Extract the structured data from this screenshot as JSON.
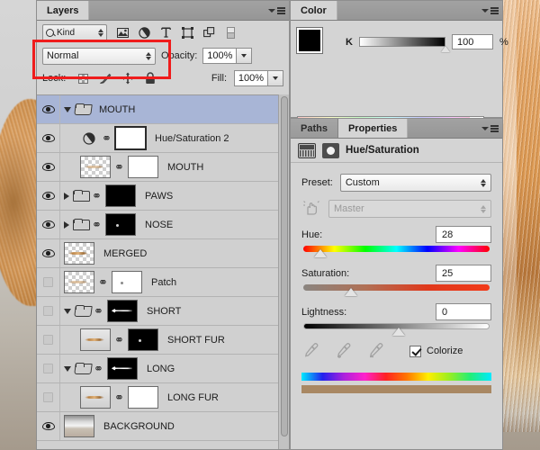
{
  "layers_panel": {
    "tab_label": "Layers",
    "panel_menu_icon": "panel-menu-icon",
    "filter": {
      "kind_label": "Kind",
      "search_icon": "magnifier-icon",
      "icons": [
        {
          "name": "filter-pixel-icon",
          "glyph": "☐"
        },
        {
          "name": "filter-adjustment-icon",
          "glyph": "◑"
        },
        {
          "name": "filter-type-icon",
          "glyph": "T"
        },
        {
          "name": "filter-shape-icon",
          "glyph": "⬚"
        },
        {
          "name": "filter-smart-object-icon",
          "glyph": "⧉"
        },
        {
          "name": "filter-toggle-icon",
          "glyph": "▤"
        }
      ]
    },
    "blend": {
      "mode": "Normal",
      "opacity_label": "Opacity:",
      "opacity_value": "100%"
    },
    "lock": {
      "label": "Lock:",
      "icons": [
        {
          "name": "lock-transparency-icon"
        },
        {
          "name": "lock-image-icon"
        },
        {
          "name": "lock-position-icon"
        },
        {
          "name": "lock-all-icon"
        }
      ],
      "fill_label": "Fill:",
      "fill_value": "100%"
    },
    "layers": [
      {
        "name": "MOUTH",
        "visible": true,
        "selected": true,
        "type": "group",
        "indent": 0,
        "expanded": true,
        "thumb": "none",
        "mask": "none",
        "linked": false
      },
      {
        "name": "Hue/Saturation 2",
        "visible": true,
        "selected": false,
        "type": "adjustment",
        "indent": 1,
        "expanded": null,
        "thumb": "adjustment",
        "mask": "white-framed",
        "linked": true
      },
      {
        "name": "MOUTH",
        "visible": true,
        "selected": false,
        "type": "pixel",
        "indent": 1,
        "expanded": null,
        "thumb": "checker",
        "mask": "white",
        "linked": true
      },
      {
        "name": "PAWS",
        "visible": true,
        "selected": false,
        "type": "group",
        "indent": 0,
        "expanded": false,
        "thumb": "none",
        "mask": "black",
        "linked": true
      },
      {
        "name": "NOSE",
        "visible": true,
        "selected": false,
        "type": "group",
        "indent": 0,
        "expanded": false,
        "thumb": "none",
        "mask": "black-dot",
        "linked": true
      },
      {
        "name": "MERGED",
        "visible": true,
        "selected": false,
        "type": "pixel",
        "indent": 0,
        "expanded": null,
        "thumb": "fur-checker",
        "mask": "none",
        "linked": false
      },
      {
        "name": "Patch",
        "visible": false,
        "selected": false,
        "type": "pixel",
        "indent": 0,
        "expanded": null,
        "thumb": "checker",
        "mask": "white-dot",
        "linked": true
      },
      {
        "name": "SHORT",
        "visible": false,
        "selected": false,
        "type": "group",
        "indent": 0,
        "expanded": true,
        "thumb": "none",
        "mask": "black-arrow",
        "linked": true
      },
      {
        "name": "SHORT FUR",
        "visible": false,
        "selected": false,
        "type": "pixel",
        "indent": 1,
        "expanded": null,
        "thumb": "fur-photo",
        "mask": "black-dot",
        "linked": true
      },
      {
        "name": "LONG",
        "visible": false,
        "selected": false,
        "type": "group",
        "indent": 0,
        "expanded": true,
        "thumb": "none",
        "mask": "black-arrow",
        "linked": true
      },
      {
        "name": "LONG FUR",
        "visible": false,
        "selected": false,
        "type": "pixel",
        "indent": 1,
        "expanded": null,
        "thumb": "fur-photo",
        "mask": "white",
        "linked": true
      },
      {
        "name": "BACKGROUND",
        "visible": true,
        "selected": false,
        "type": "pixel",
        "indent": 0,
        "expanded": null,
        "thumb": "background",
        "mask": "none",
        "linked": false
      }
    ]
  },
  "color_panel": {
    "tab_label": "Color",
    "channel_label": "K",
    "channel_value": "100",
    "percent_symbol": "%",
    "foreground_color": "#000000",
    "background_color": "#ffffff"
  },
  "properties_panel": {
    "tabs": [
      {
        "label": "Paths",
        "active": false
      },
      {
        "label": "Properties",
        "active": true
      }
    ],
    "title": "Hue/Saturation",
    "preset_label": "Preset:",
    "preset_value": "Custom",
    "channel_value": "Master",
    "hue": {
      "label": "Hue:",
      "value": "28"
    },
    "saturation": {
      "label": "Saturation:",
      "value": "25"
    },
    "lightness": {
      "label": "Lightness:",
      "value": "0"
    },
    "colorize_label": "Colorize",
    "colorize_checked": true,
    "result_color": "#a98863"
  },
  "annotation": {
    "name": "red-highlight-box",
    "color": "#ef1c1c"
  }
}
